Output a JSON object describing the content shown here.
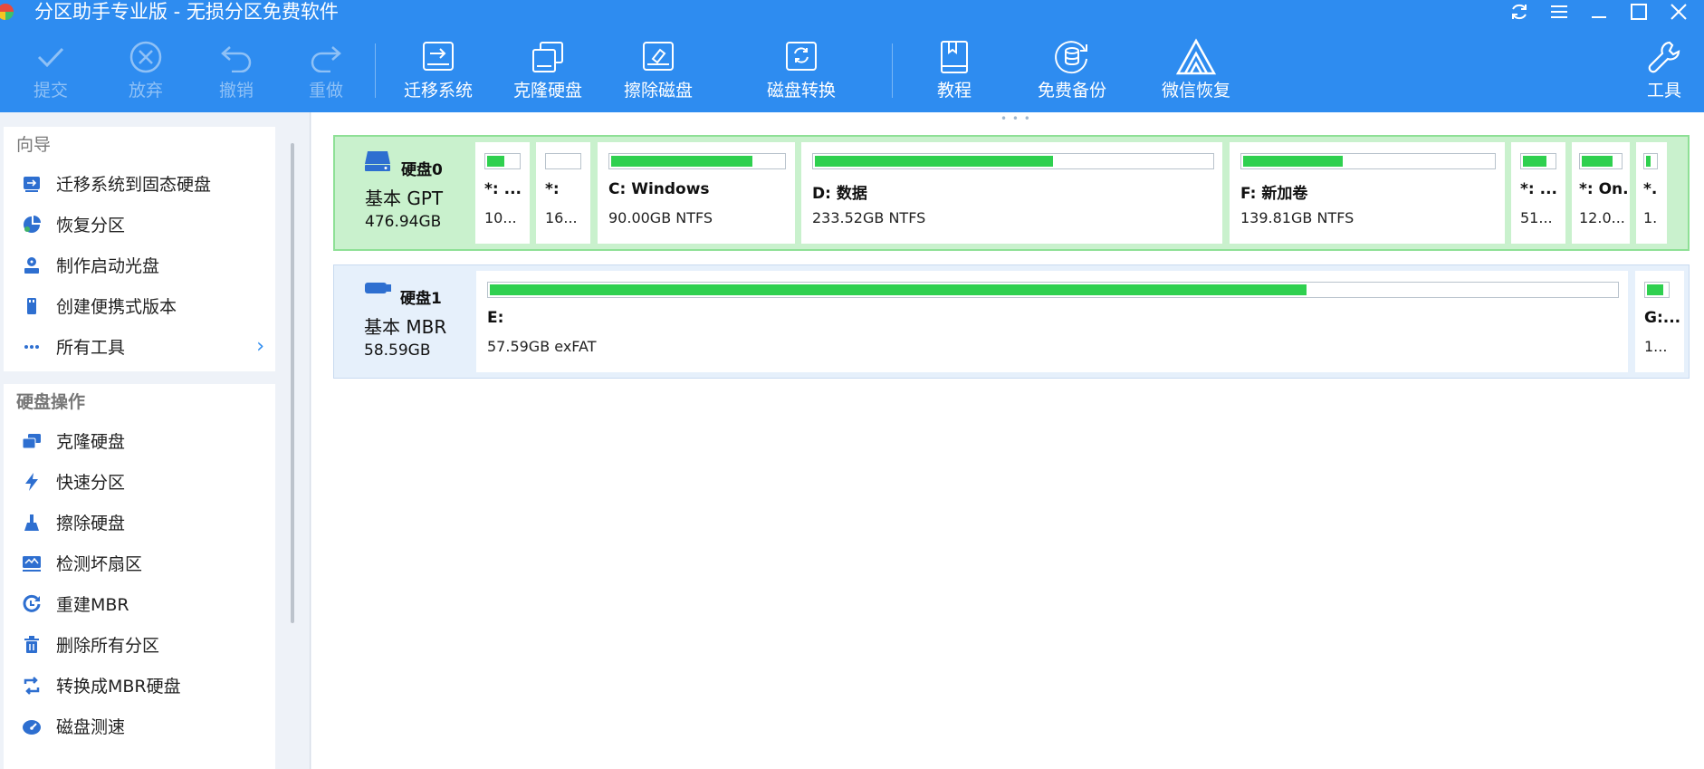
{
  "app": {
    "title": "分区助手专业版 - 无损分区免费软件"
  },
  "toolbar": {
    "commit": "提交",
    "discard": "放弃",
    "undo": "撤销",
    "redo": "重做",
    "migrate_os": "迁移系统",
    "clone_disk": "克隆硬盘",
    "wipe_disk": "擦除磁盘",
    "disk_convert": "磁盘转换",
    "tutorial": "教程",
    "free_backup": "免费备份",
    "wechat_recovery": "微信恢复",
    "tools": "工具"
  },
  "sidebar": {
    "guide_title": "向导",
    "guide_items": [
      {
        "label": "迁移系统到固态硬盘",
        "icon": "migrate-ssd-icon"
      },
      {
        "label": "恢复分区",
        "icon": "recover-partition-icon"
      },
      {
        "label": "制作启动光盘",
        "icon": "bootable-media-icon"
      },
      {
        "label": "创建便携式版本",
        "icon": "portable-version-icon"
      },
      {
        "label": "所有工具",
        "icon": "more-icon"
      }
    ],
    "disk_ops_title": "硬盘操作",
    "disk_ops_items": [
      {
        "label": "克隆硬盘",
        "icon": "clone-disk-icon"
      },
      {
        "label": "快速分区",
        "icon": "quick-partition-icon"
      },
      {
        "label": "擦除硬盘",
        "icon": "wipe-disk-icon"
      },
      {
        "label": "检测坏扇区",
        "icon": "bad-sector-icon"
      },
      {
        "label": "重建MBR",
        "icon": "rebuild-mbr-icon"
      },
      {
        "label": "删除所有分区",
        "icon": "delete-all-icon"
      },
      {
        "label": "转换成MBR硬盘",
        "icon": "convert-mbr-icon"
      },
      {
        "label": "磁盘测速",
        "icon": "disk-speed-icon"
      }
    ]
  },
  "disks": [
    {
      "name": "硬盘0",
      "type": "基本 GPT",
      "size": "476.94GB",
      "partitions": [
        {
          "name": "*: ...",
          "info": "10...",
          "used": 0.55
        },
        {
          "name": "*:",
          "info": "16...",
          "used": 0.0
        },
        {
          "name": "C: Windows",
          "info": "90.00GB NTFS",
          "used": 0.82
        },
        {
          "name": "D: 数据",
          "info": "233.52GB NTFS",
          "used": 0.6
        },
        {
          "name": "F: 新加卷",
          "info": "139.81GB NTFS",
          "used": 0.4
        },
        {
          "name": "*: ...",
          "info": "51...",
          "used": 0.75
        },
        {
          "name": "*: On...",
          "info": "12.0...",
          "used": 0.8
        },
        {
          "name": "*.",
          "info": "1.",
          "used": 0.5
        }
      ]
    },
    {
      "name": "硬盘1",
      "type": "基本 MBR",
      "size": "58.59GB",
      "partitions": [
        {
          "name": "E:",
          "info": "57.59GB exFAT",
          "used": 0.725
        },
        {
          "name": "G:...",
          "info": "1...",
          "used": 0.8
        }
      ]
    }
  ],
  "colors": {
    "accent": "#2e8cf0",
    "used_fill": "#2fd04f",
    "selected_disk_bg": "#c9f1cd"
  }
}
